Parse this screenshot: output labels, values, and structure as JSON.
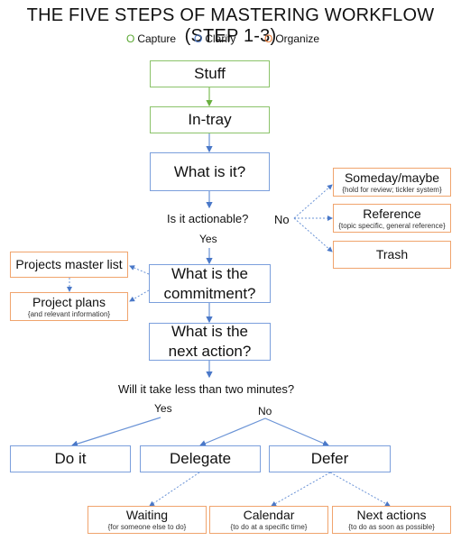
{
  "title": "THE FIVE STEPS OF MASTERING WORKFLOW (STEP 1-3)",
  "legend": [
    {
      "mark": "O",
      "label": "Capture",
      "color": "#5aa832"
    },
    {
      "mark": "O",
      "label": "Clarify",
      "color": "#4a78c8"
    },
    {
      "mark": "O",
      "label": "Organize",
      "color": "#ec7a35"
    }
  ],
  "nodes": {
    "stuff": {
      "label": "Stuff"
    },
    "in_tray": {
      "label": "In-tray"
    },
    "what_is_it": {
      "label": "What is it?"
    },
    "what_commitment": {
      "label": "What is the commitment?"
    },
    "next_action": {
      "label": "What is the next action?"
    },
    "someday": {
      "label": "Someday/maybe",
      "note": "{hold for review; tickler system}"
    },
    "reference": {
      "label": "Reference",
      "note": "{topic specific, general reference}"
    },
    "trash": {
      "label": "Trash"
    },
    "projects_master": {
      "label": "Projects master list"
    },
    "project_plans": {
      "label": "Project plans",
      "note": "{and relevant information}"
    },
    "do_it": {
      "label": "Do it"
    },
    "delegate": {
      "label": "Delegate"
    },
    "defer": {
      "label": "Defer"
    },
    "waiting": {
      "label": "Waiting",
      "note": "{for someone else to do}"
    },
    "calendar": {
      "label": "Calendar",
      "note": "{to do at a specific time}"
    },
    "next_actions": {
      "label": "Next actions",
      "note": "{to do as soon as possible}"
    }
  },
  "labels": {
    "is_actionable": "Is it actionable?",
    "yes1": "Yes",
    "no1": "No",
    "two_minutes": "Will it take less than two minutes?",
    "yes2": "Yes",
    "no2": "No"
  },
  "colors": {
    "capture": "#8bc36a",
    "clarify": "#7b9fdc",
    "organize": "#f0a46d",
    "arrow": "#4a78c8"
  }
}
